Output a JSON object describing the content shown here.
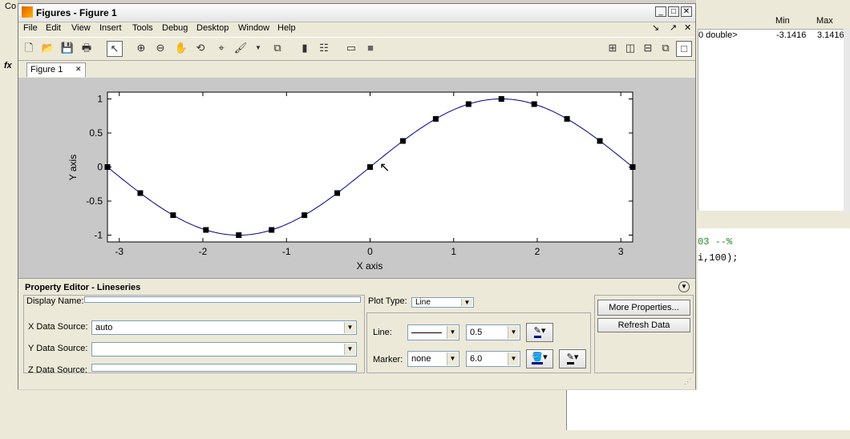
{
  "window": {
    "title": "Figures - Figure 1"
  },
  "menu": [
    "File",
    "Edit",
    "View",
    "Insert",
    "Tools",
    "Debug",
    "Desktop",
    "Window",
    "Help"
  ],
  "tab": {
    "label": "Figure 1"
  },
  "chart_data": {
    "type": "line",
    "xlabel": "X axis",
    "ylabel": "Y axis",
    "xlim": [
      -3.1416,
      3.1416
    ],
    "ylim": [
      -1.1,
      1.1
    ],
    "xticks": [
      "-3",
      "-2",
      "-1",
      "0",
      "1",
      "2",
      "3"
    ],
    "yticks": [
      "-1",
      "-0.5",
      "0",
      "0.5",
      "1"
    ],
    "series": [
      {
        "function": "sin",
        "x_markers": [
          -3.1416,
          -2.7489,
          -2.3562,
          -1.9635,
          -1.5708,
          -1.1781,
          -0.7854,
          -0.3927,
          0.0,
          0.3927,
          0.7854,
          1.1781,
          1.5708,
          1.9635,
          2.3562,
          2.7489,
          3.1416
        ],
        "color": "#00008b"
      }
    ]
  },
  "property_editor": {
    "title": "Property Editor - Lineseries",
    "display_name_label": "Display Name:",
    "plot_type_label": "Plot Type:",
    "plot_type_value": "Line",
    "x_source_label": "X Data Source:",
    "x_source_value": "auto",
    "y_source_label": "Y Data Source:",
    "z_source_label": "Z Data Source:",
    "line_label": "Line:",
    "line_width": "0.5",
    "marker_label": "Marker:",
    "marker_value": "none",
    "marker_size": "6.0",
    "more_properties": "More Properties...",
    "refresh_data": "Refresh Data"
  },
  "workspace": {
    "col_min": "Min",
    "col_max": "Max",
    "row_type": "0 double>",
    "row_min": "-3.1416",
    "row_max": "3.1416"
  },
  "command": {
    "line1": "03 --%",
    "line2": "i,100);"
  },
  "desktop": {
    "corner_label": "Co",
    "fx_label": "fx"
  }
}
